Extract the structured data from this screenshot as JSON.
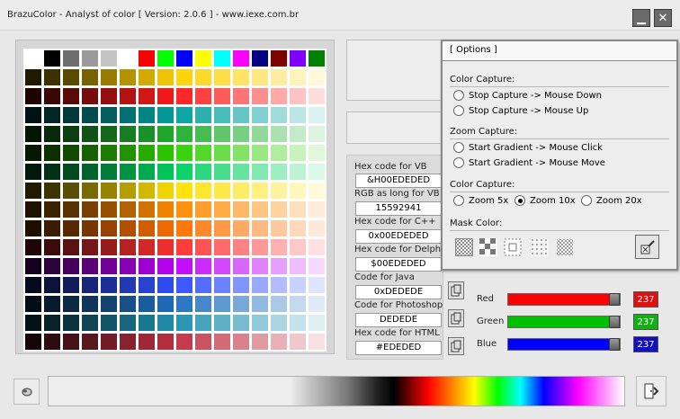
{
  "window": {
    "title": "BrazuColor - Analyst of color [ Version: 2.0.6 ] - www.iexe.com.br"
  },
  "palette": {
    "first_row": [
      "#ffffff",
      "#000000",
      "#6e6e6e",
      "#9a9a9a",
      "#c4c4c4",
      "#ffffff",
      "#ff0000",
      "#00ff00",
      "#0000ff",
      "#ffff00",
      "#00ffff",
      "#ff00ff",
      "#000080",
      "#800000",
      "#8000ff",
      "#008000",
      "#0080ff"
    ],
    "hues": [
      "#ffd000",
      "#ff1a1a",
      "#00a0a0",
      "#20b030",
      "#2fd000",
      "#00d060",
      "#ffe000",
      "#ff8a00",
      "#ff7000",
      "#ff3030",
      "#c000ff",
      "#3050ff",
      "#2070c0",
      "#2090b0",
      "#c03040",
      "#888888"
    ]
  },
  "codes": [
    {
      "label": "Hex code for VB",
      "value": "&H00EDEDED"
    },
    {
      "label": "RGB as long for VB",
      "value": "15592941"
    },
    {
      "label": "Hex code for C++",
      "value": "0x00EDEDED"
    },
    {
      "label": "Hex code for Delphi",
      "value": "$00EDEDED"
    },
    {
      "label": "Code for Java",
      "value": "0xDEDEDE"
    },
    {
      "label": "Code for Photoshop",
      "value": "DEDEDE"
    },
    {
      "label": "Hex code for HTML",
      "value": "#EDEDED"
    }
  ],
  "rgb": [
    {
      "label": "Red",
      "value": "237",
      "color": "#ff0000",
      "box": "#e01010"
    },
    {
      "label": "Green",
      "value": "237",
      "color": "#00c000",
      "box": "#10b010"
    },
    {
      "label": "Blue",
      "value": "237",
      "color": "#0000ff",
      "box": "#1010c0"
    }
  ],
  "options": {
    "header": "[ Options ]",
    "color_capture": {
      "title": "Color Capture:",
      "items": [
        "Stop Capture -> Mouse Down",
        "Stop Capture -> Mouse Up"
      ]
    },
    "zoom_capture": {
      "title": "Zoom Capture:",
      "items": [
        "Start Gradient -> Mouse Click",
        "Start Gradient -> Mouse Move"
      ]
    },
    "zoom": {
      "title": "Color Capture:",
      "items": [
        "Zoom 5x",
        "Zoom 10x",
        "Zoom 20x"
      ],
      "selected": "Zoom 10x"
    },
    "mask": {
      "title": "Mask Color:"
    }
  }
}
